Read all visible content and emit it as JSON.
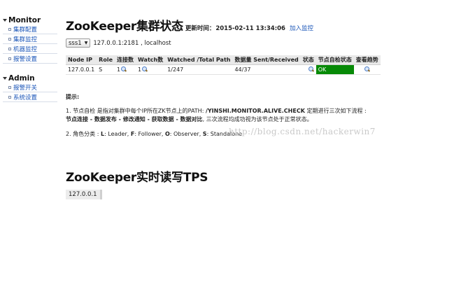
{
  "sidebar": {
    "groups": [
      {
        "title": "Monitor",
        "items": [
          "集群配置",
          "集群监控",
          "机器监控",
          "报警设置"
        ]
      },
      {
        "title": "Admin",
        "items": [
          "报警开关",
          "系统设置"
        ]
      }
    ]
  },
  "header": {
    "title": "ZooKeeper集群状态",
    "update_label": "更新时间：",
    "update_time": "2015-02-11 13:34:06",
    "join_link": "加入监控"
  },
  "cluster": {
    "selected": "sss1",
    "host": "127.0.0.1:2181 , localhost"
  },
  "table": {
    "columns": [
      "Node IP",
      "Role",
      "连接数",
      "Watch数",
      "Watched /Total Path",
      "数据量 Sent/Received",
      "状态",
      "节点自检状态",
      "查看趋势"
    ],
    "rows": [
      {
        "node_ip": "127.0.0.1",
        "role": "S",
        "connections": "1",
        "watches": "1",
        "watched_total": "1/247",
        "sent_received": "44/37",
        "self_check": "OK"
      }
    ]
  },
  "tips": {
    "heading": "提示:",
    "tip1_a": "1. 节点自检 是指对集群中每个IP所在ZK节点上的PATH: ",
    "tip1_path": "/YINSHI.MONITOR.ALIVE.CHECK",
    "tip1_b": " 定期进行三次如下流程 : ",
    "tip1_steps": "节点连接 - 数据发布 - 修改通知 - 获取数据 - 数据对比",
    "tip1_c": ", 三次流程均成功视为该节点处于正常状态。",
    "tip2_prefix": "2. 角色分类 : ",
    "tip2_l": "L",
    "tip2_l_text": ": Leader, ",
    "tip2_f": "F",
    "tip2_f_text": ": Follower, ",
    "tip2_o": "O",
    "tip2_o_text": ": Observer, ",
    "tip2_s": "S",
    "tip2_s_text": ": Standalone"
  },
  "watermark": "http://blog.csdn.net/hackerwin7",
  "tps": {
    "title": "ZooKeeper实时读写TPS",
    "host": "127.0.0.1"
  },
  "colors": {
    "link": "#1a55b8",
    "ok_bg": "#078a07",
    "header_bg": "#e9e9e9"
  }
}
